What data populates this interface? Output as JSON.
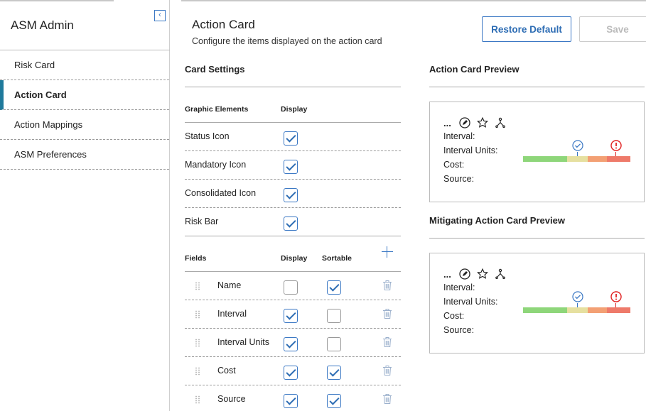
{
  "sidebar": {
    "title": "ASM Admin",
    "items": [
      {
        "label": "Risk Card"
      },
      {
        "label": "Action Card"
      },
      {
        "label": "Action Mappings"
      },
      {
        "label": "ASM Preferences"
      }
    ],
    "active_item": "Action Card"
  },
  "header": {
    "title": "Action Card",
    "subtitle": "Configure the items displayed on the action card",
    "restore_label": "Restore Default",
    "save_label": "Save"
  },
  "card_settings": {
    "title": "Card Settings",
    "graphic_elements": {
      "col_name": "Graphic Elements",
      "col_display": "Display",
      "rows": [
        {
          "label": "Status Icon",
          "display": true
        },
        {
          "label": "Mandatory Icon",
          "display": true
        },
        {
          "label": "Consolidated Icon",
          "display": true
        },
        {
          "label": "Risk Bar",
          "display": true
        }
      ]
    },
    "fields": {
      "col_name": "Fields",
      "col_display": "Display",
      "col_sortable": "Sortable",
      "rows": [
        {
          "label": "Name",
          "display": false,
          "sortable": true
        },
        {
          "label": "Interval",
          "display": true,
          "sortable": false
        },
        {
          "label": "Interval Units",
          "display": true,
          "sortable": false
        },
        {
          "label": "Cost",
          "display": true,
          "sortable": true
        },
        {
          "label": "Source",
          "display": true,
          "sortable": true
        }
      ]
    }
  },
  "action_preview": {
    "title": "Action Card Preview",
    "dots": "...",
    "lines": [
      "Interval:",
      "Interval Units:",
      "Cost:",
      "Source:"
    ]
  },
  "mitigating_preview": {
    "title": "Mitigating Action Card Preview",
    "dots": "...",
    "lines": [
      "Interval:",
      "Interval Units:",
      "Cost:",
      "Source:"
    ]
  },
  "colors": {
    "accent": "#3b78c4",
    "active_marker": "#1f7a9c",
    "risk_green": "#8ed67a",
    "risk_yellow": "#e6e0a0",
    "risk_orange": "#f3a074",
    "risk_red": "#ee7a6a",
    "alert_red": "#e02020"
  }
}
